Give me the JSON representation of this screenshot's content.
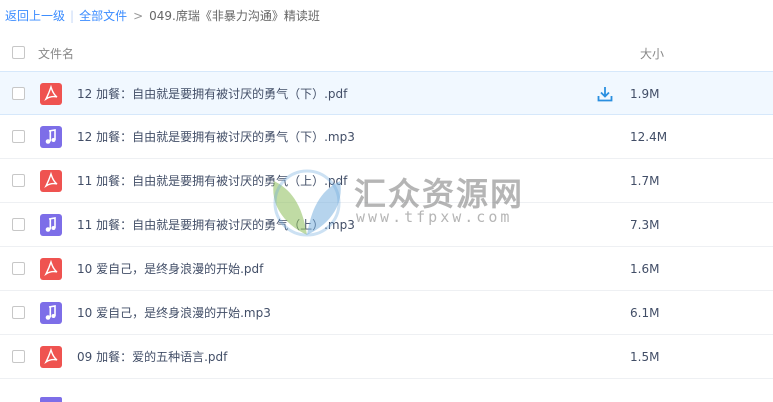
{
  "breadcrumb": {
    "back": "返回上一级",
    "all_files": "全部文件",
    "current": "049.席瑞《非暴力沟通》精读班"
  },
  "header": {
    "name": "文件名",
    "size": "大小"
  },
  "files": [
    {
      "name": "12 加餐：自由就是要拥有被讨厌的勇气（下）.pdf",
      "size": "1.9M",
      "type": "pdf"
    },
    {
      "name": "12 加餐：自由就是要拥有被讨厌的勇气（下）.mp3",
      "size": "12.4M",
      "type": "mp3"
    },
    {
      "name": "11 加餐：自由就是要拥有被讨厌的勇气（上）.pdf",
      "size": "1.7M",
      "type": "pdf"
    },
    {
      "name": "11 加餐：自由就是要拥有被讨厌的勇气（上）.mp3",
      "size": "7.3M",
      "type": "mp3"
    },
    {
      "name": "10 爱自己，是终身浪漫的开始.pdf",
      "size": "1.6M",
      "type": "pdf"
    },
    {
      "name": "10 爱自己，是终身浪漫的开始.mp3",
      "size": "6.1M",
      "type": "mp3"
    },
    {
      "name": "09 加餐：爱的五种语言.pdf",
      "size": "1.5M",
      "type": "pdf"
    }
  ],
  "watermark": {
    "title": "汇众资源网",
    "url": "www.tfpxw.com"
  },
  "icons": {
    "pdf": "pdf-file-icon",
    "mp3": "audio-file-icon",
    "download": "download-icon"
  },
  "colors": {
    "link": "#3b8cff",
    "pdf": "#ef5350",
    "mp3": "#7d6ee8",
    "hover_row": "#f1f8ff",
    "download": "#2a8fe0"
  }
}
